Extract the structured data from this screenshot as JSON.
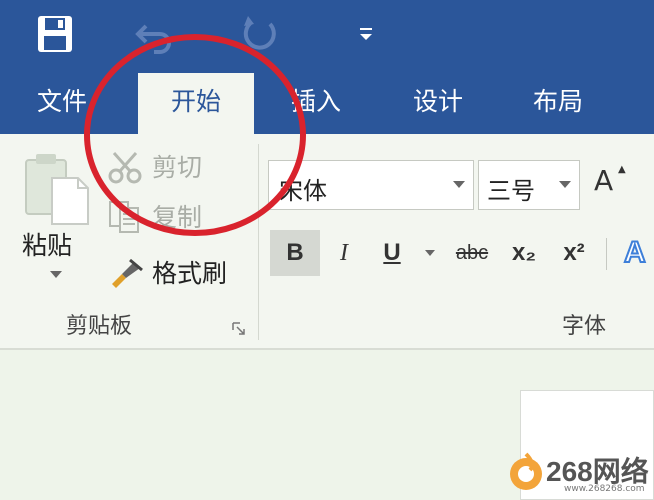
{
  "quick_access": {
    "icons": [
      "save-icon",
      "undo-icon",
      "redo-icon",
      "customize-qat-icon"
    ]
  },
  "tabs": [
    {
      "label": "文件",
      "active": false
    },
    {
      "label": "开始",
      "active": true
    },
    {
      "label": "插入",
      "active": false
    },
    {
      "label": "设计",
      "active": false
    },
    {
      "label": "布局",
      "active": false
    }
  ],
  "clipboard": {
    "paste_label": "粘贴",
    "cut_label": "剪切",
    "copy_label": "复制",
    "format_painter_label": "格式刷",
    "group_label": "剪贴板"
  },
  "font": {
    "font_name": "宋体",
    "font_size": "三号",
    "grow_font": "A",
    "bold": "B",
    "italic": "I",
    "underline": "U",
    "strikethrough": "abc",
    "subscript": "x₂",
    "superscript": "x²",
    "text_effects": "A",
    "group_label": "字体"
  },
  "watermark": {
    "text": "268网络",
    "url": "www.268268.com"
  },
  "colors": {
    "accent": "#2b569a",
    "highlight_circle": "#d9232d"
  }
}
